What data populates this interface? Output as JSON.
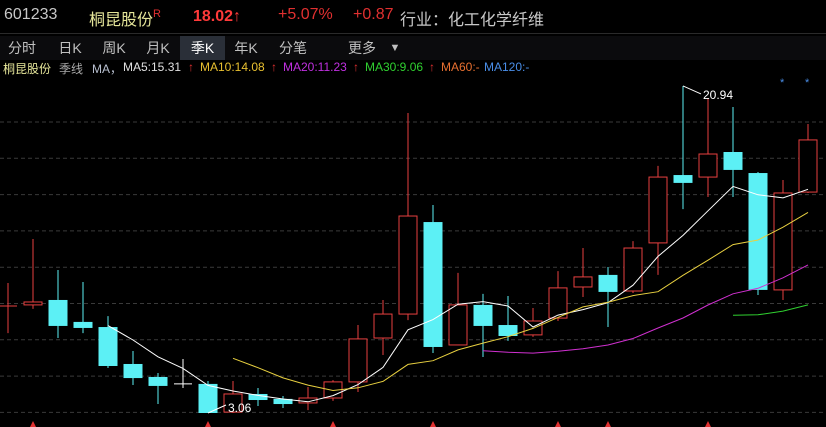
{
  "header": {
    "code": "601233",
    "name": "桐昆股份",
    "name_mark": "R",
    "price": "18.02",
    "price_arrow": "↑",
    "change_pct": "+5.07%",
    "change": "+0.87",
    "industry": "行业：化工化学纤维"
  },
  "tabs": [
    {
      "label": "分时"
    },
    {
      "label": "日K"
    },
    {
      "label": "周K"
    },
    {
      "label": "月K"
    },
    {
      "label": "季K",
      "active": true
    },
    {
      "label": "年K"
    },
    {
      "label": "分笔"
    },
    {
      "label": "更多"
    }
  ],
  "more_icon": "triangle-down-icon",
  "legend": {
    "name": "桐昆股份",
    "period": "季线",
    "ma": "MA，",
    "ma5": "MA5:15.31",
    "ma10": "MA10:14.08",
    "ma20": "MA20:11.23",
    "ma30": "MA30:9.06",
    "ma60": "MA60:-",
    "ma120": "MA120:-",
    "arrow": "↑"
  },
  "colors": {
    "up": "#e84040",
    "down": "#5cf0f5",
    "ma5": "#ffffff",
    "ma10": "#e8d040",
    "ma20": "#d030d0",
    "ma30": "#30d030",
    "ma60": "#e87030",
    "ma120": "#4a8ee8"
  },
  "chart_data": {
    "type": "candlestick",
    "period": "quarterly",
    "fields": [
      "open",
      "close",
      "high",
      "low"
    ],
    "candles": [
      [
        8.91,
        8.91,
        10.17,
        7.43
      ],
      [
        8.97,
        9.13,
        12.57,
        8.75
      ],
      [
        9.24,
        7.82,
        10.88,
        7.16
      ],
      [
        8.04,
        7.71,
        10.22,
        7.43
      ],
      [
        7.76,
        5.63,
        8.36,
        5.52
      ],
      [
        5.74,
        4.97,
        6.45,
        4.59
      ],
      [
        5.03,
        4.54,
        5.25,
        3.55
      ],
      [
        4.65,
        4.65,
        6.01,
        4.43
      ],
      [
        4.65,
        3.06,
        4.81,
        3.06
      ],
      [
        3.11,
        4.1,
        4.81,
        3.06
      ],
      [
        4.1,
        3.77,
        4.43,
        3.44
      ],
      [
        3.83,
        3.55,
        3.99,
        3.33
      ],
      [
        3.61,
        3.88,
        4.48,
        3.22
      ],
      [
        3.88,
        4.76,
        4.86,
        3.72
      ],
      [
        4.76,
        7.11,
        7.87,
        4.21
      ],
      [
        7.16,
        8.47,
        9.24,
        6.23
      ],
      [
        8.47,
        13.83,
        19.46,
        8.14
      ],
      [
        13.5,
        6.67,
        14.43,
        6.34
      ],
      [
        6.78,
        8.97,
        10.72,
        6.78
      ],
      [
        8.97,
        7.82,
        9.57,
        6.12
      ],
      [
        7.87,
        7.27,
        9.46,
        7.0
      ],
      [
        7.33,
        8.09,
        8.8,
        7.22
      ],
      [
        8.25,
        9.9,
        10.82,
        8.09
      ],
      [
        9.95,
        10.5,
        12.08,
        9.4
      ],
      [
        10.61,
        9.68,
        11.04,
        7.76
      ],
      [
        9.73,
        12.08,
        12.46,
        9.62
      ],
      [
        12.36,
        15.96,
        16.57,
        10.61
      ],
      [
        16.07,
        15.64,
        20.94,
        14.21
      ],
      [
        15.96,
        17.22,
        20.28,
        14.87
      ],
      [
        17.33,
        16.35,
        19.79,
        14.87
      ],
      [
        16.18,
        9.79,
        16.24,
        9.51
      ],
      [
        9.79,
        15.09,
        15.8,
        9.24
      ],
      [
        15.14,
        17.99,
        18.86,
        15.09
      ]
    ],
    "ma_periods": [
      5,
      10,
      20,
      30
    ],
    "max_label": "20.94",
    "min_label": "3.06",
    "max_index": 27,
    "min_index": 8,
    "event_marker_indices": [
      1,
      8,
      13,
      17,
      22,
      24,
      28
    ],
    "star_marker_indices": [
      31,
      32
    ],
    "ylim": [
      2.6,
      21.5
    ],
    "grid": true
  }
}
